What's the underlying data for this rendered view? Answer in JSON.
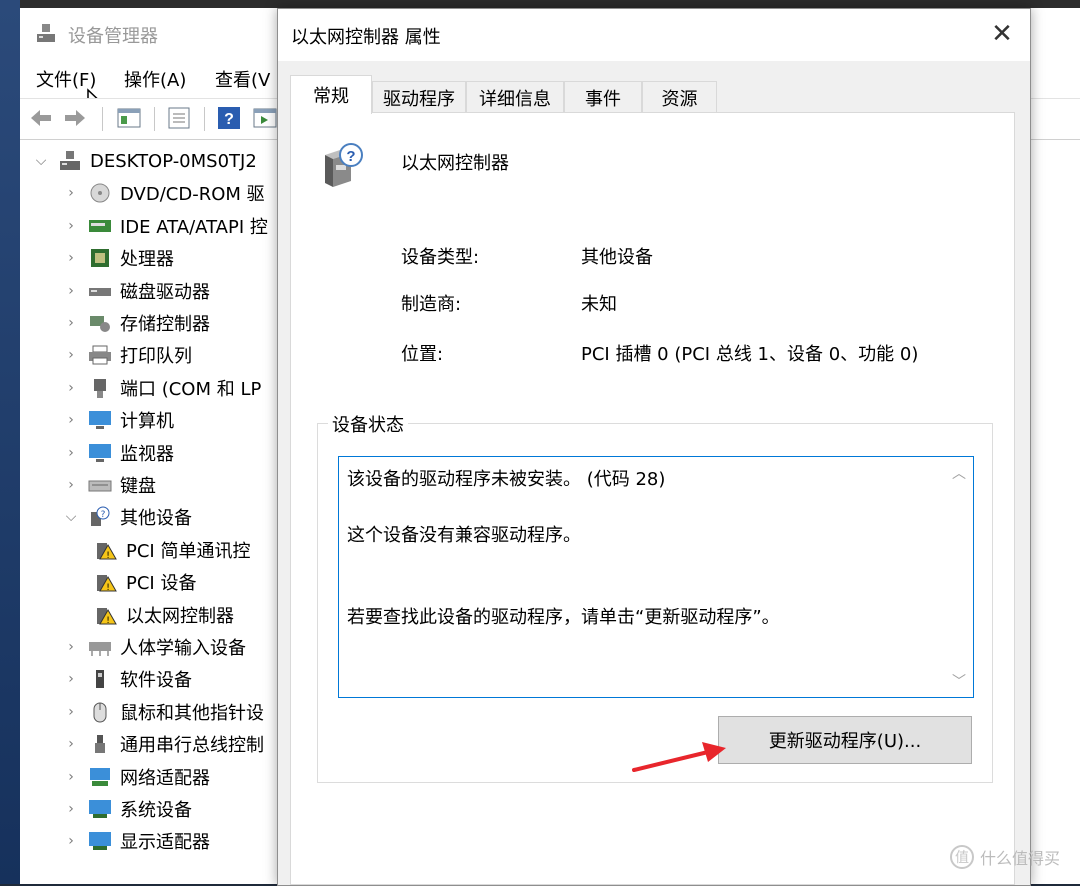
{
  "device_manager": {
    "title": "设备管理器",
    "menus": [
      {
        "label": "文件(F)"
      },
      {
        "label": "操作(A)"
      },
      {
        "label": "查看(V"
      }
    ],
    "tree": {
      "root": "DESKTOP-0MS0TJ2",
      "items": [
        {
          "label": "DVD/CD-ROM 驱",
          "icon": "dvd-icon"
        },
        {
          "label": "IDE ATA/ATAPI 控",
          "icon": "ide-controller-icon"
        },
        {
          "label": "处理器",
          "icon": "processor-icon"
        },
        {
          "label": "磁盘驱动器",
          "icon": "disk-drive-icon"
        },
        {
          "label": "存储控制器",
          "icon": "storage-controller-icon"
        },
        {
          "label": "打印队列",
          "icon": "printer-icon"
        },
        {
          "label": "端口 (COM 和 LP",
          "icon": "port-icon"
        },
        {
          "label": "计算机",
          "icon": "computer-icon"
        },
        {
          "label": "监视器",
          "icon": "monitor-icon"
        },
        {
          "label": "键盘",
          "icon": "keyboard-icon"
        },
        {
          "label": "其他设备",
          "icon": "unknown-device-icon",
          "expanded": true
        },
        {
          "label": "PCI 简单通讯控",
          "icon": "warning-device-icon",
          "child": true
        },
        {
          "label": "PCI 设备",
          "icon": "warning-device-icon",
          "child": true
        },
        {
          "label": "以太网控制器",
          "icon": "warning-device-icon",
          "child": true
        },
        {
          "label": "人体学输入设备",
          "icon": "hid-icon"
        },
        {
          "label": "软件设备",
          "icon": "software-device-icon"
        },
        {
          "label": "鼠标和其他指针设",
          "icon": "mouse-icon"
        },
        {
          "label": "通用串行总线控制",
          "icon": "usb-icon"
        },
        {
          "label": "网络适配器",
          "icon": "network-adapter-icon"
        },
        {
          "label": "系统设备",
          "icon": "system-device-icon"
        },
        {
          "label": "显示适配器",
          "icon": "display-adapter-icon"
        }
      ]
    }
  },
  "dialog": {
    "title": "以太网控制器 属性",
    "close_label": "✕",
    "tabs": [
      {
        "label": "常规",
        "active": true
      },
      {
        "label": "驱动程序"
      },
      {
        "label": "详细信息"
      },
      {
        "label": "事件"
      },
      {
        "label": "资源"
      }
    ],
    "device_name": "以太网控制器",
    "properties": [
      {
        "label": "设备类型:",
        "value": "其他设备"
      },
      {
        "label": "制造商:",
        "value": "未知"
      },
      {
        "label": "位置:",
        "value": "PCI 插槽 0 (PCI 总线 1、设备 0、功能 0)"
      }
    ],
    "status_group_title": "设备状态",
    "status_lines": [
      "该设备的驱动程序未被安装。 (代码 28)",
      "这个设备没有兼容驱动程序。",
      "若要查找此设备的驱动程序，请单击“更新驱动程序”。"
    ],
    "update_button": "更新驱动程序(U)..."
  },
  "watermark": {
    "badge": "值",
    "text": "什么值得买"
  },
  "colors": {
    "focus_border": "#0078d7",
    "annotation_arrow": "#e8262c"
  }
}
